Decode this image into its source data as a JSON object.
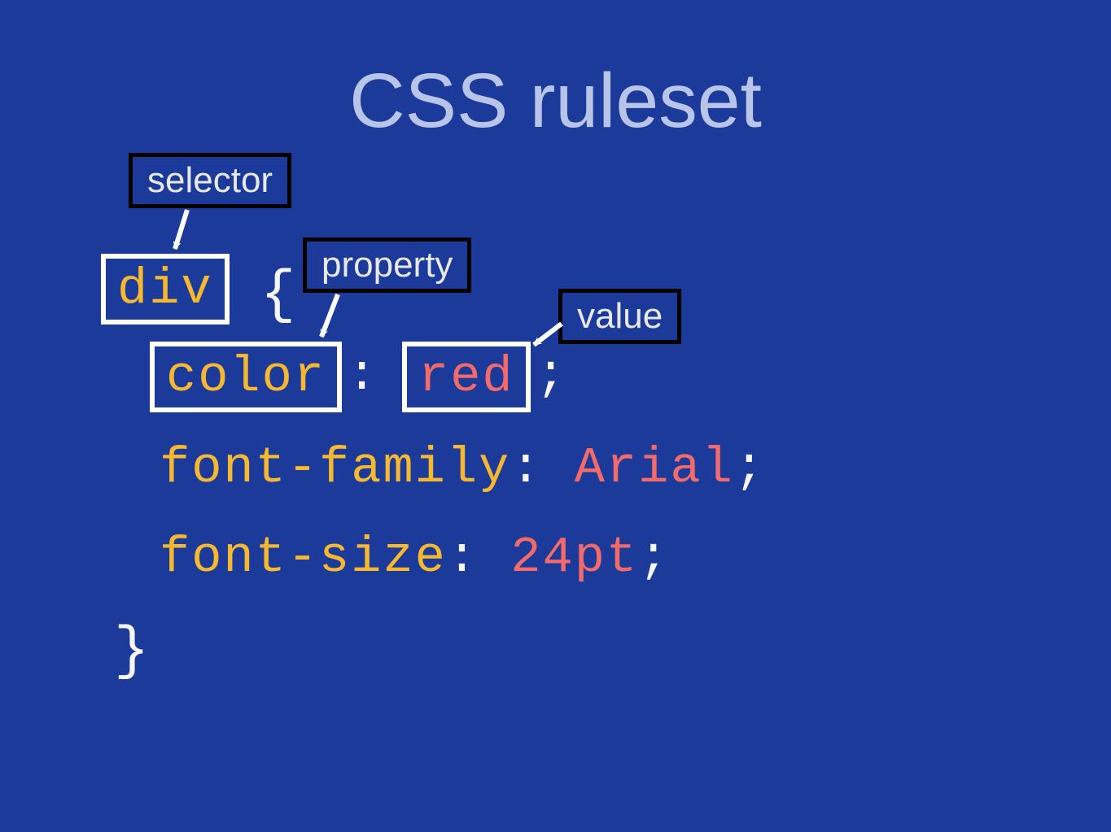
{
  "title": "CSS ruleset",
  "labels": {
    "selector": "selector",
    "property": "property",
    "value": "value"
  },
  "code": {
    "selector": "div",
    "brace_open": "{",
    "decl1_prop": "color",
    "decl1_colon": ":",
    "decl1_val": "red",
    "decl1_semi": ";",
    "decl2_prop": "font-family",
    "decl2_colon": ": ",
    "decl2_val": "Arial",
    "decl2_semi": ";",
    "decl3_prop": "font-size",
    "decl3_colon": ": ",
    "decl3_val": "24pt",
    "decl3_semi": ";",
    "brace_close": "}"
  }
}
